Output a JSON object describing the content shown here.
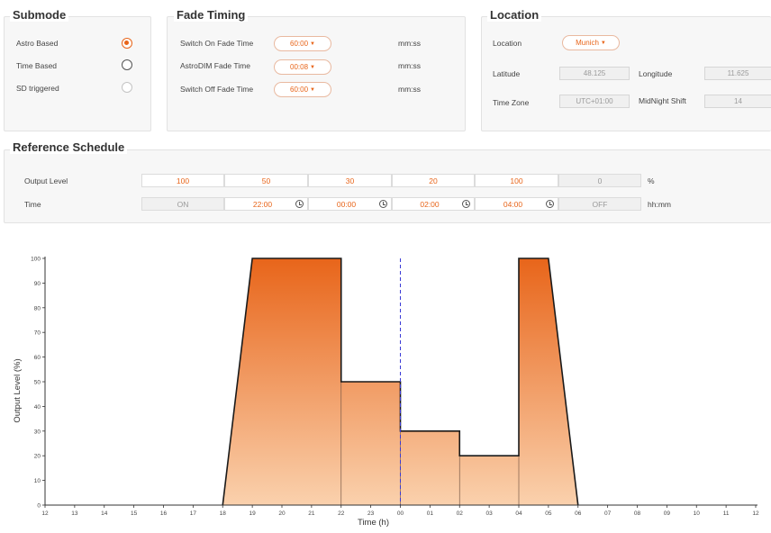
{
  "submode": {
    "title": "Submode",
    "options": [
      {
        "label": "Astro Based",
        "state": "selected"
      },
      {
        "label": "Time Based",
        "state": "unselected"
      },
      {
        "label": "SD triggered",
        "state": "disabled"
      }
    ]
  },
  "fade_timing": {
    "title": "Fade Timing",
    "rows": [
      {
        "label": "Switch On Fade Time",
        "value": "60:00",
        "unit": "mm:ss"
      },
      {
        "label": "AstroDIM Fade Time",
        "value": "00:08",
        "unit": "mm:ss"
      },
      {
        "label": "Switch Off Fade Time",
        "value": "60:00",
        "unit": "mm:ss"
      }
    ]
  },
  "location": {
    "title": "Location",
    "location_label": "Location",
    "location_value": "Munich",
    "latitude_label": "Latitude",
    "latitude_value": "48.125",
    "longitude_label": "Longitude",
    "longitude_value": "11.625",
    "timezone_label": "Time Zone",
    "timezone_value": "UTC+01:00",
    "midnight_label": "MidNight Shift",
    "midnight_value": "14"
  },
  "reference_schedule": {
    "title": "Reference Schedule",
    "output_label": "Output Level",
    "output_unit": "%",
    "output_values": [
      "100",
      "50",
      "30",
      "20",
      "100",
      "0"
    ],
    "time_label": "Time",
    "time_unit": "hh:mm",
    "time_values": [
      "ON",
      "22:00",
      "00:00",
      "02:00",
      "04:00",
      "OFF"
    ]
  },
  "colors": {
    "accent": "#e8651a",
    "fill_top": "#e8651a",
    "fill_bottom": "#fad1ad",
    "midnight_line": "#3a3ad6"
  },
  "chart_data": {
    "type": "area",
    "xlabel": "Time (h)",
    "ylabel": "Output Level (%)",
    "ylim": [
      0,
      100
    ],
    "yticks": [
      0,
      10,
      20,
      30,
      40,
      50,
      60,
      70,
      80,
      90,
      100
    ],
    "xtick_labels": [
      "12",
      "13",
      "14",
      "15",
      "16",
      "17",
      "18",
      "19",
      "20",
      "21",
      "22",
      "23",
      "00",
      "01",
      "02",
      "03",
      "04",
      "05",
      "06",
      "07",
      "08",
      "09",
      "10",
      "11",
      "12"
    ],
    "points": [
      {
        "x": "18",
        "y": 0
      },
      {
        "x": "19",
        "y": 100
      },
      {
        "x": "22",
        "y": 100
      },
      {
        "x": "22",
        "y": 50
      },
      {
        "x": "00",
        "y": 50
      },
      {
        "x": "00",
        "y": 30
      },
      {
        "x": "02",
        "y": 30
      },
      {
        "x": "02",
        "y": 20
      },
      {
        "x": "04",
        "y": 20
      },
      {
        "x": "04",
        "y": 100
      },
      {
        "x": "05",
        "y": 100
      },
      {
        "x": "06",
        "y": 0
      }
    ],
    "midnight_marker_x": "00",
    "grid": false
  }
}
